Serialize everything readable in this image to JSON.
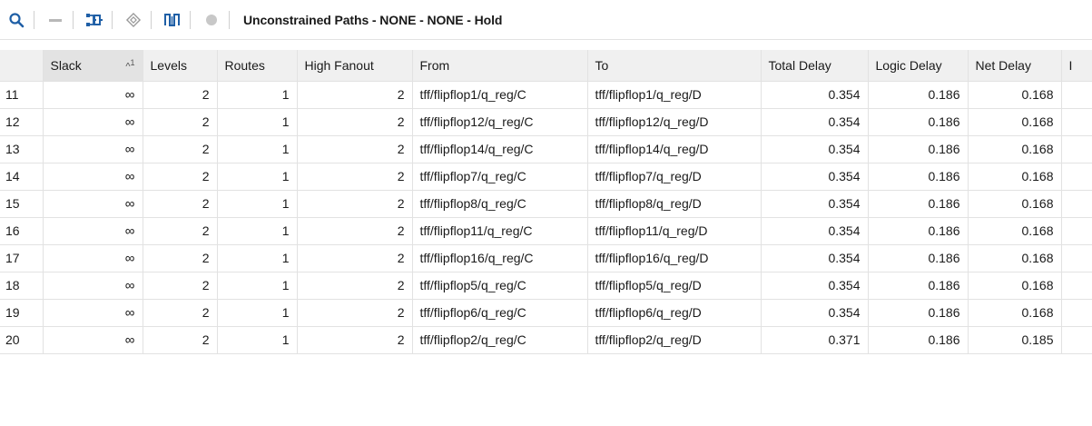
{
  "toolbar": {
    "title": "Unconstrained Paths - NONE - NONE - Hold",
    "buttons": [
      {
        "name": "search-icon"
      },
      {
        "name": "collapse-icon"
      },
      {
        "name": "schematic-icon"
      },
      {
        "name": "path-properties-icon"
      },
      {
        "name": "waveform-icon"
      },
      {
        "name": "highlight-icon"
      }
    ]
  },
  "table": {
    "sort_indicator": "^",
    "sort_order": "1",
    "columns": [
      "",
      "Slack",
      "Levels",
      "Routes",
      "High Fanout",
      "From",
      "To",
      "Total Delay",
      "Logic Delay",
      "Net Delay",
      "I"
    ],
    "rows": [
      {
        "id": "11",
        "slack": "∞",
        "levels": "2",
        "routes": "1",
        "fanout": "2",
        "from": "tff/flipflop1/q_reg/C",
        "to": "tff/flipflop1/q_reg/D",
        "total": "0.354",
        "logic": "0.186",
        "net": "0.168"
      },
      {
        "id": "12",
        "slack": "∞",
        "levels": "2",
        "routes": "1",
        "fanout": "2",
        "from": "tff/flipflop12/q_reg/C",
        "to": "tff/flipflop12/q_reg/D",
        "total": "0.354",
        "logic": "0.186",
        "net": "0.168"
      },
      {
        "id": "13",
        "slack": "∞",
        "levels": "2",
        "routes": "1",
        "fanout": "2",
        "from": "tff/flipflop14/q_reg/C",
        "to": "tff/flipflop14/q_reg/D",
        "total": "0.354",
        "logic": "0.186",
        "net": "0.168"
      },
      {
        "id": "14",
        "slack": "∞",
        "levels": "2",
        "routes": "1",
        "fanout": "2",
        "from": "tff/flipflop7/q_reg/C",
        "to": "tff/flipflop7/q_reg/D",
        "total": "0.354",
        "logic": "0.186",
        "net": "0.168"
      },
      {
        "id": "15",
        "slack": "∞",
        "levels": "2",
        "routes": "1",
        "fanout": "2",
        "from": "tff/flipflop8/q_reg/C",
        "to": "tff/flipflop8/q_reg/D",
        "total": "0.354",
        "logic": "0.186",
        "net": "0.168"
      },
      {
        "id": "16",
        "slack": "∞",
        "levels": "2",
        "routes": "1",
        "fanout": "2",
        "from": "tff/flipflop11/q_reg/C",
        "to": "tff/flipflop11/q_reg/D",
        "total": "0.354",
        "logic": "0.186",
        "net": "0.168"
      },
      {
        "id": "17",
        "slack": "∞",
        "levels": "2",
        "routes": "1",
        "fanout": "2",
        "from": "tff/flipflop16/q_reg/C",
        "to": "tff/flipflop16/q_reg/D",
        "total": "0.354",
        "logic": "0.186",
        "net": "0.168"
      },
      {
        "id": "18",
        "slack": "∞",
        "levels": "2",
        "routes": "1",
        "fanout": "2",
        "from": "tff/flipflop5/q_reg/C",
        "to": "tff/flipflop5/q_reg/D",
        "total": "0.354",
        "logic": "0.186",
        "net": "0.168"
      },
      {
        "id": "19",
        "slack": "∞",
        "levels": "2",
        "routes": "1",
        "fanout": "2",
        "from": "tff/flipflop6/q_reg/C",
        "to": "tff/flipflop6/q_reg/D",
        "total": "0.354",
        "logic": "0.186",
        "net": "0.168"
      },
      {
        "id": "20",
        "slack": "∞",
        "levels": "2",
        "routes": "1",
        "fanout": "2",
        "from": "tff/flipflop2/q_reg/C",
        "to": "tff/flipflop2/q_reg/D",
        "total": "0.371",
        "logic": "0.186",
        "net": "0.185"
      }
    ]
  },
  "colors": {
    "accent": "#1f5fa6",
    "header_bg": "#f0f0f0",
    "grid_line": "#e2e2e2"
  }
}
